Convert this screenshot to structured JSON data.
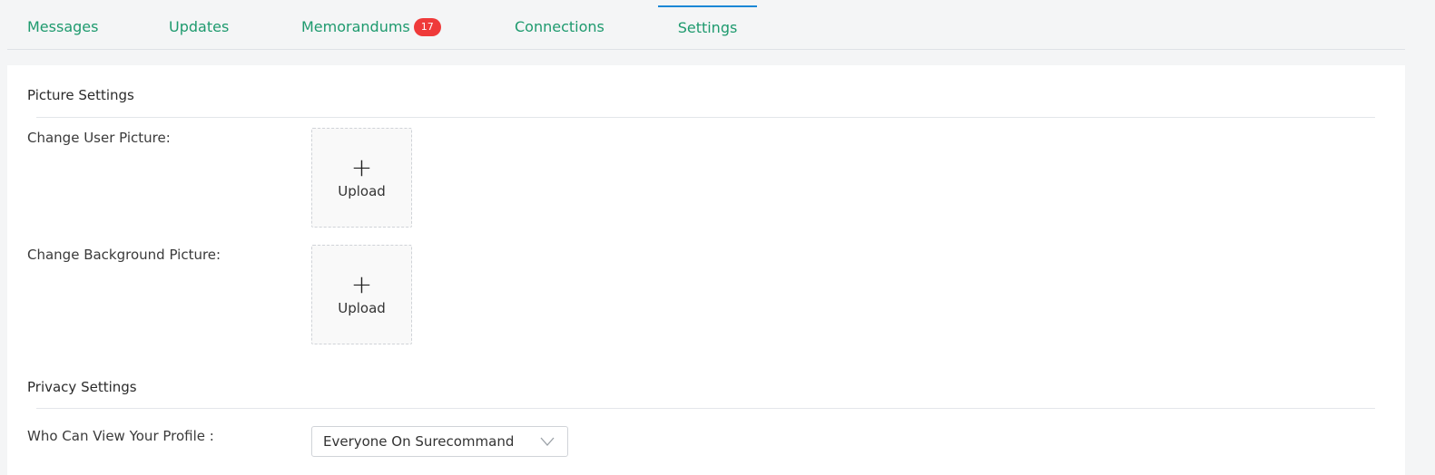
{
  "tabs": [
    {
      "label": "Messages"
    },
    {
      "label": "Updates"
    },
    {
      "label": "Memorandums",
      "badge": "17"
    },
    {
      "label": "Connections"
    },
    {
      "label": "Settings",
      "active": true
    }
  ],
  "picture_settings": {
    "title": "Picture Settings",
    "user_picture_label": "Change User Picture:",
    "background_picture_label": "Change Background Picture:",
    "upload_label": "Upload"
  },
  "privacy_settings": {
    "title": "Privacy Settings",
    "profile_view_label": "Who Can View Your Profile :",
    "profile_view_value": "Everyone On Surecommand"
  },
  "colors": {
    "tab_text": "#1e9a6e",
    "active_tab_border": "#1b87d6",
    "badge_bg": "#ef3a3a"
  }
}
